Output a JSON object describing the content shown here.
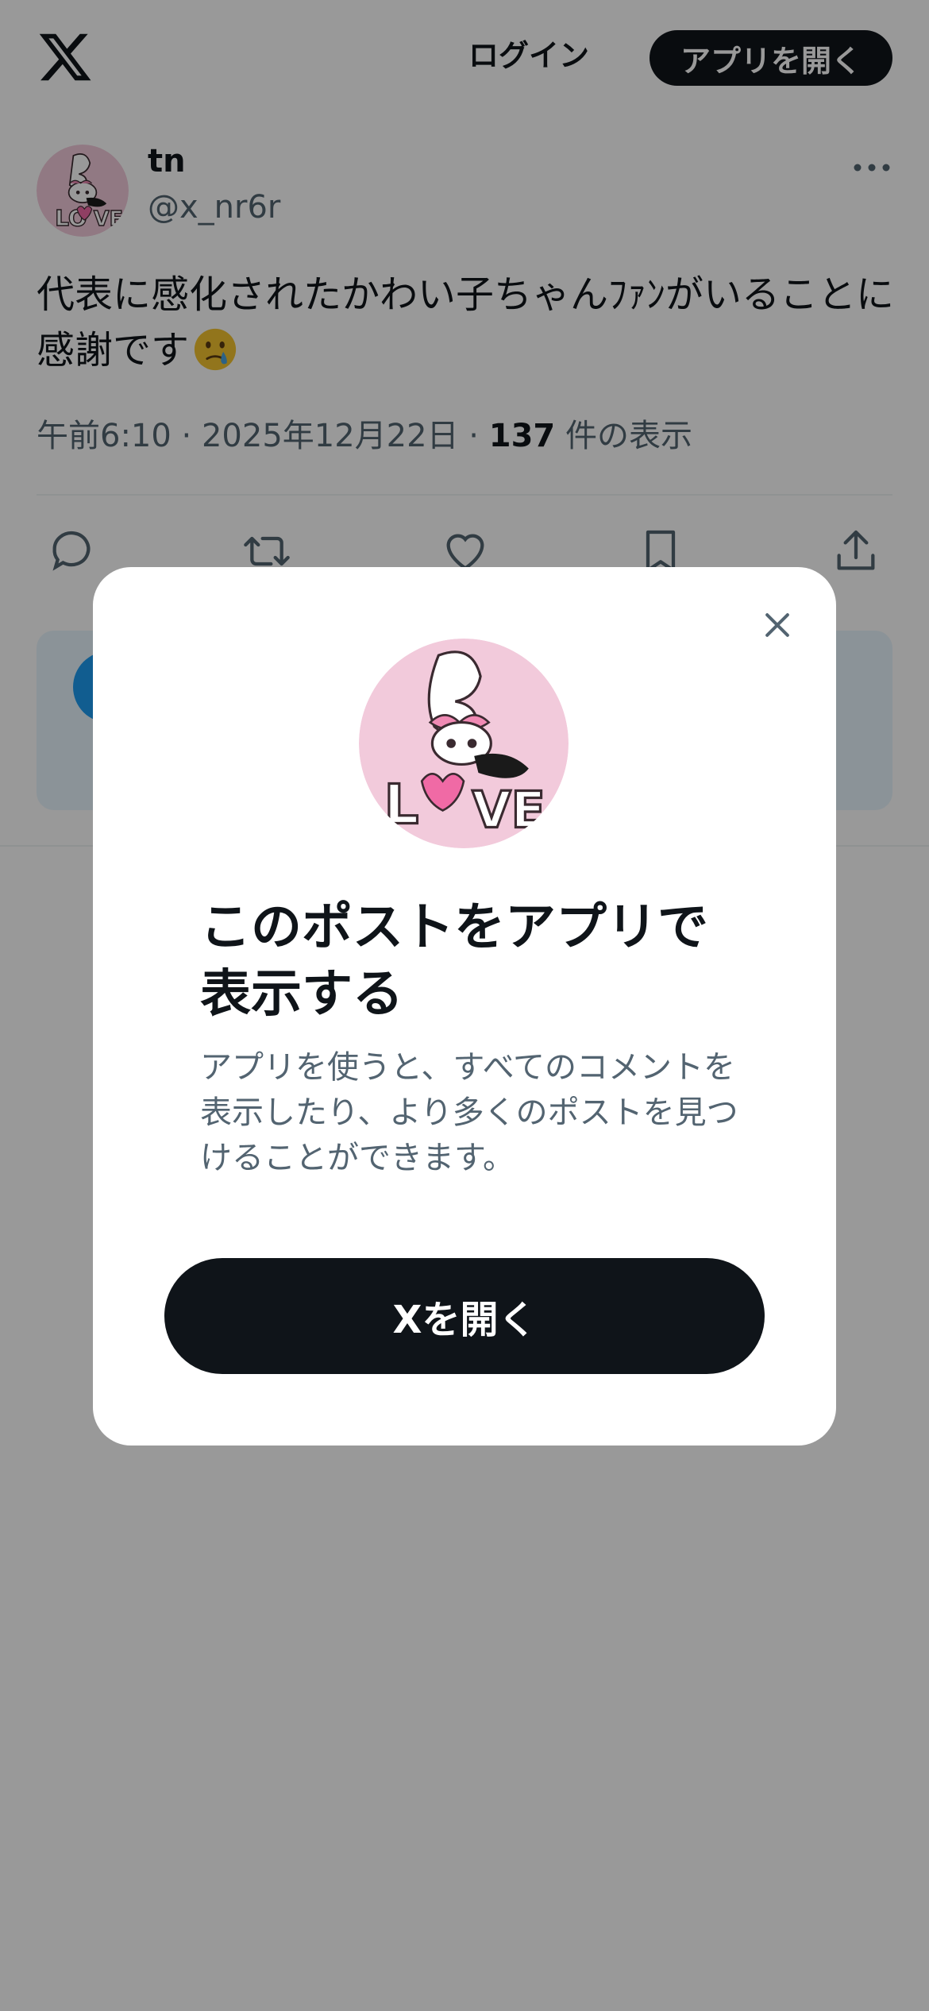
{
  "header": {
    "logo_icon": "x-logo-icon",
    "login_label": "ログイン",
    "open_app_label": "アプリを開く"
  },
  "post": {
    "username": "tn",
    "handle": "@x_nr6r",
    "text": "代表に感化されたかわい子ちゃんﾌｧﾝがいることに感謝です",
    "emoji_icon": "face-holding-back-tears-emoji",
    "time": "午前6:10",
    "date": "2025年12月22日",
    "views_count": "137",
    "views_label": "件の表示",
    "separator": "·",
    "actions": [
      "reply-icon",
      "repost-icon",
      "like-icon",
      "bookmark-icon",
      "share-icon"
    ]
  },
  "modal": {
    "title": "このポストをアプリで表示する",
    "description": "アプリを使うと、すべてのコメントを表示したり、より多くのポストを見つけることができます。",
    "open_button_label": "Xを開く",
    "close_icon": "close-icon"
  },
  "colors": {
    "primary_text": "#0f1419",
    "secondary_text": "#536471",
    "button_bg": "#0f1419",
    "overlay": "rgba(0,0,0,0.40)",
    "avatar_pink": "#f2cadb"
  }
}
